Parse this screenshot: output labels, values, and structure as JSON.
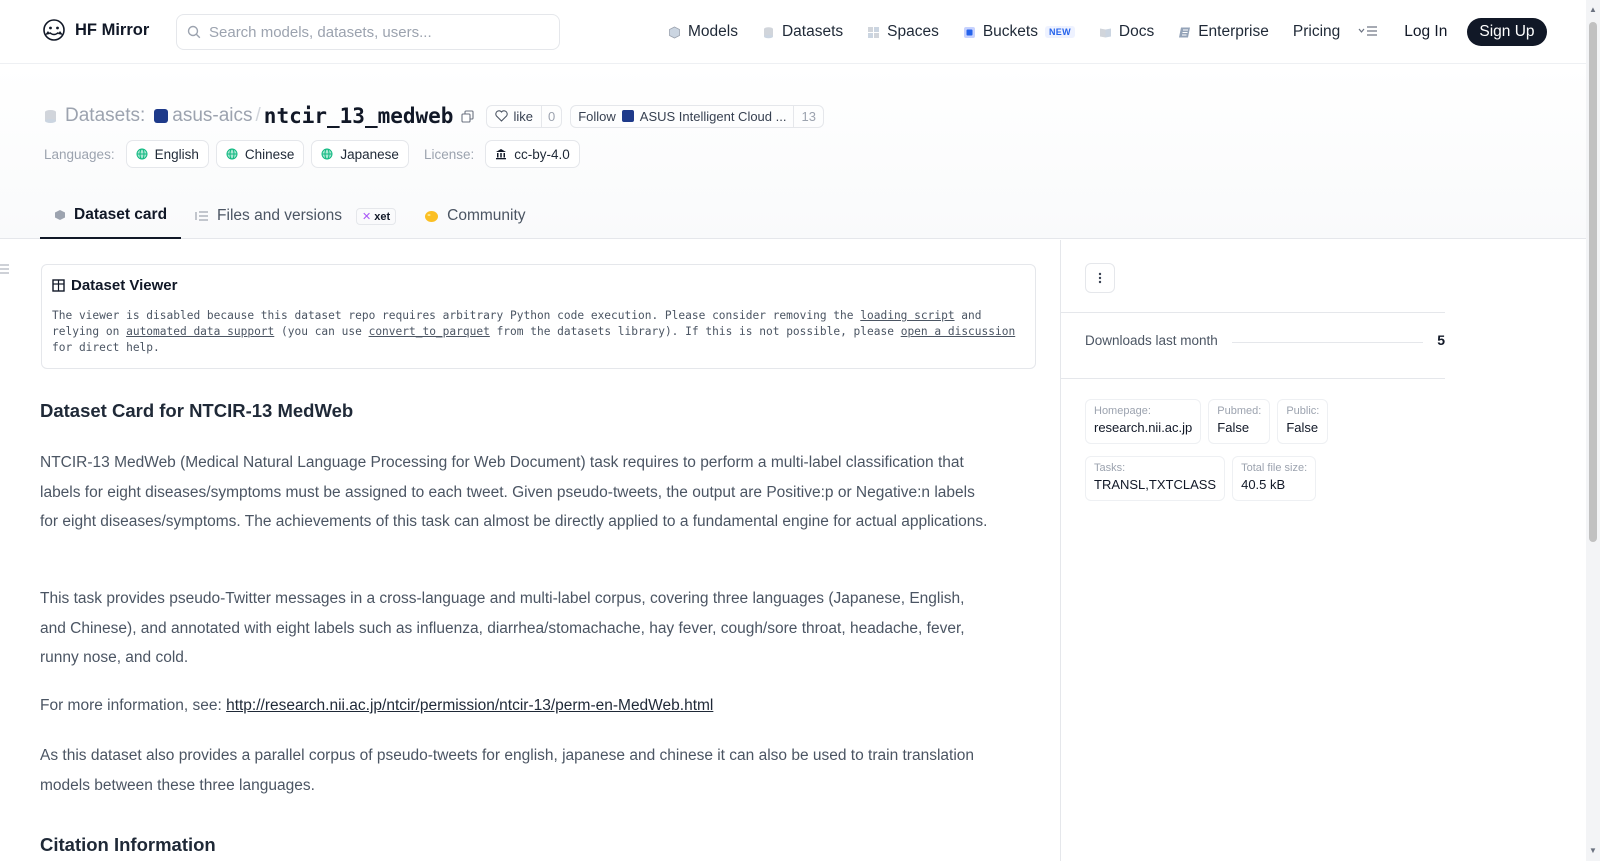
{
  "nav": {
    "brand": "HF Mirror",
    "search_placeholder": "Search models, datasets, users...",
    "links": [
      {
        "label": "Models",
        "icon": "models-icon"
      },
      {
        "label": "Datasets",
        "icon": "datasets-icon"
      },
      {
        "label": "Spaces",
        "icon": "spaces-icon"
      },
      {
        "label": "Buckets",
        "icon": "buckets-icon",
        "badge": "NEW"
      },
      {
        "label": "Docs",
        "icon": "docs-icon"
      },
      {
        "label": "Enterprise",
        "icon": "enterprise-icon"
      },
      {
        "label": "Pricing"
      }
    ],
    "login": "Log In",
    "signup": "Sign Up"
  },
  "repo": {
    "prefix": "Datasets:",
    "org": "asus-aics",
    "separator": "/",
    "name": "ntcir_13_medweb",
    "like_label": "like",
    "like_count": "0",
    "follow_label": "Follow",
    "follow_org": "ASUS Intelligent Cloud ...",
    "follow_count": "13"
  },
  "tags": {
    "languages_label": "Languages:",
    "languages": [
      "English",
      "Chinese",
      "Japanese"
    ],
    "license_label": "License:",
    "license": "cc-by-4.0"
  },
  "tabs": {
    "dataset_card": "Dataset card",
    "files": "Files and versions",
    "xet_badge": "xet",
    "community": "Community"
  },
  "viewer": {
    "title": "Dataset Viewer",
    "msg_1": "The viewer is disabled because this dataset repo requires arbitrary Python code execution. Please consider removing the ",
    "link_loading_script": "loading script",
    "msg_2": " and relying on ",
    "link_automated": "automated data support",
    "msg_3": " (you can use ",
    "link_convert": "convert_to_parquet",
    "msg_4": " from the datasets library). If this is not possible, please ",
    "link_discussion": "open a discussion",
    "msg_5": " for direct help."
  },
  "card": {
    "heading": "Dataset Card for NTCIR-13 MedWeb",
    "p1": "NTCIR-13 MedWeb (Medical Natural Language Processing for Web Document) task requires to perform a multi-label classification that labels for eight diseases/symptoms must be assigned to each tweet. Given pseudo-tweets, the output are Positive:p or Negative:n labels for eight diseases/symptoms. The achievements of this task can almost be directly applied to a fundamental engine for actual applications.",
    "p2": "This task provides pseudo-Twitter messages in a cross-language and multi-label corpus, covering three languages (Japanese, English, and Chinese), and annotated with eight labels such as influenza, diarrhea/stomachache, hay fever, cough/sore throat, headache, fever, runny nose, and cold.",
    "p3_prefix": "For more information, see: ",
    "p3_link": "http://research.nii.ac.jp/ntcir/permission/ntcir-13/perm-en-MedWeb.html",
    "p4": "As this dataset also provides a parallel corpus of pseudo-tweets for english, japanese and chinese it can also be used to train translation models between these three languages.",
    "next_heading": "Citation Information"
  },
  "sidebar": {
    "downloads_label": "Downloads last month",
    "downloads_value": "5",
    "meta": [
      {
        "k": "Homepage:",
        "v": "research.nii.ac.jp"
      },
      {
        "k": "Pubmed:",
        "v": "False"
      },
      {
        "k": "Public:",
        "v": "False"
      },
      {
        "k": "Tasks:",
        "v": "TRANSL,TXTCLASS"
      },
      {
        "k": "Total file size:",
        "v": "40.5 kB"
      }
    ]
  }
}
